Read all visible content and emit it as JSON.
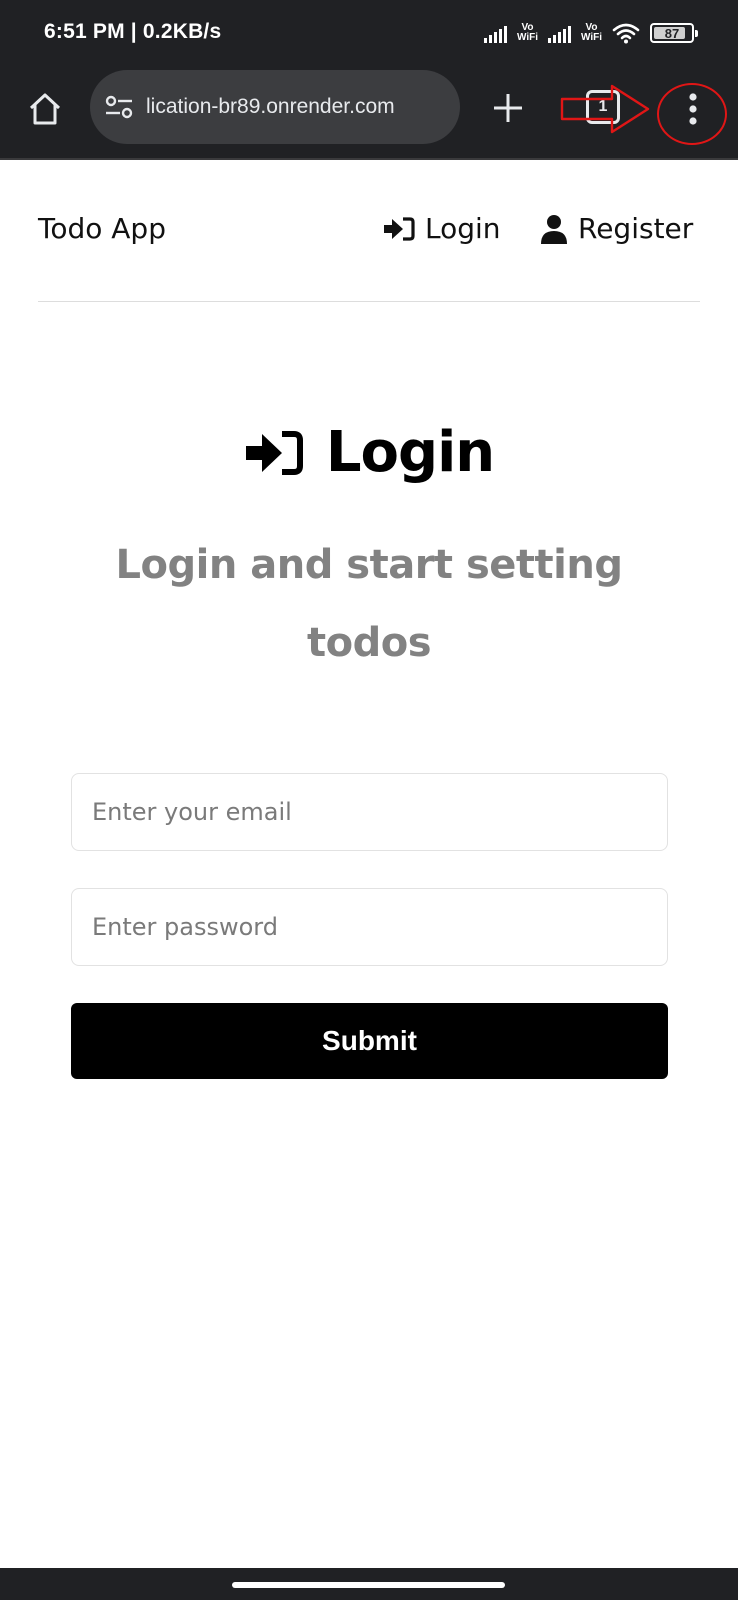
{
  "status_bar": {
    "time": "6:51 PM | 0.2KB/s",
    "vowifi_label_top": "Vo",
    "vowifi_label_bottom": "WiFi",
    "battery_level": "87"
  },
  "browser": {
    "url": "lication-br89.onrender.com",
    "tab_count": "1",
    "annotation_color": "#e01616"
  },
  "nav": {
    "app_title": "Todo App",
    "login_label": "Login",
    "register_label": "Register"
  },
  "login": {
    "heading": "Login",
    "subtitle": "Login and start setting todos",
    "email_placeholder": "Enter your email",
    "password_placeholder": "Enter password",
    "submit_label": "Submit"
  },
  "icons": {
    "home": "home-icon",
    "site_settings": "tune-icon",
    "new_tab": "plus-icon",
    "menu": "kebab-menu-icon",
    "login": "sign-in-icon",
    "register": "user-icon"
  }
}
